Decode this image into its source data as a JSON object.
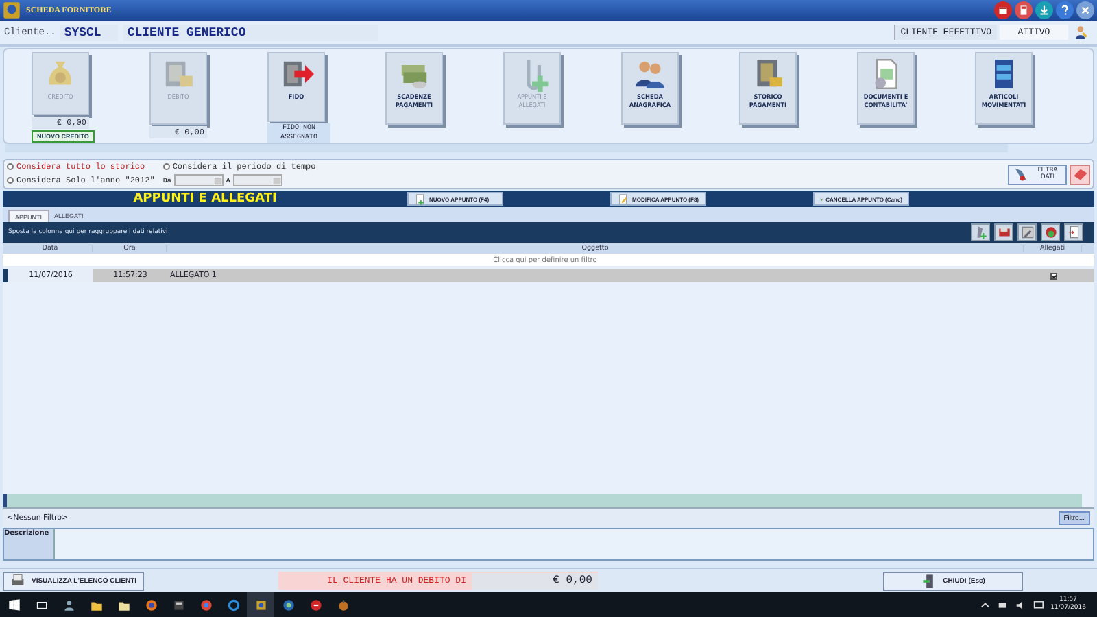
{
  "window": {
    "title": "SCHEDA FORNITORE"
  },
  "client": {
    "label": "Cliente..",
    "code": "SYSCL",
    "name": "CLIENTE GENERICO",
    "status_label": "CLIENTE EFFETTIVO",
    "status": "ATTIVO"
  },
  "tiles": [
    {
      "kind": "credit",
      "label": "CREDITO",
      "disabled": true,
      "value": "€ 0,00",
      "action": "NUOVO CREDITO"
    },
    {
      "kind": "debit",
      "label": "DEBITO",
      "disabled": true,
      "value": "€ 0,00"
    },
    {
      "kind": "fido",
      "label": "FIDO",
      "disabled": false,
      "note": "FIDO NON ASSEGNATO"
    },
    {
      "kind": "money",
      "label": "SCADENZE PAGAMENTI",
      "disabled": false
    },
    {
      "kind": "clip",
      "label": "APPUNTI E ALLEGATI",
      "disabled": true
    },
    {
      "kind": "people",
      "label": "SCHEDA ANAGRAFICA",
      "disabled": false
    },
    {
      "kind": "safe",
      "label": "STORICO PAGAMENTI",
      "disabled": false
    },
    {
      "kind": "doc",
      "label": "DOCUMENTI E CONTABILITA'",
      "disabled": false
    },
    {
      "kind": "cabinet",
      "label": "ARTICOLI MOVIMENTATI",
      "disabled": false
    }
  ],
  "period": {
    "options": [
      {
        "label": "Considera tutto lo storico",
        "selected": false,
        "emphasis": true
      },
      {
        "label": "Considera il periodo di tempo",
        "selected": false,
        "emphasis": false
      },
      {
        "label": "Considera Solo l'anno \"2012\"",
        "selected": false,
        "emphasis": false
      }
    ],
    "from_label": "Da",
    "to_label": "A",
    "filter_button": "FILTRA DATI"
  },
  "section": {
    "title": "APPUNTI E ALLEGATI",
    "actions": [
      {
        "kind": "new",
        "label": "NUOVO APPUNTO (F4)"
      },
      {
        "kind": "edit",
        "label": "MODIFICA APPUNTO (F8)"
      },
      {
        "kind": "delete",
        "label": "CANCELLA APPUNTO (Canc)"
      }
    ]
  },
  "tabs": [
    {
      "label": "APPUNTI",
      "selected": true
    },
    {
      "label": "ALLEGATI",
      "selected": false
    }
  ],
  "group_hint": "Sposta la colonna qui per raggruppare i dati relativi",
  "table": {
    "columns": [
      "Data",
      "Ora",
      "Oggetto",
      "Allegati"
    ],
    "filter_placeholder": "Clicca qui per definire un filtro",
    "rows": [
      {
        "date": "11/07/2016",
        "time": "11:57:23",
        "subject": "ALLEGATO 1",
        "attached": true
      }
    ]
  },
  "filter_footer": {
    "text": "<Nessun Filtro>",
    "button": "Filtro..."
  },
  "description": {
    "label": "Descrizione"
  },
  "bottom": {
    "list_button": "VISUALIZZA L'ELENCO CLIENTI",
    "message": "IL CLIENTE HA UN DEBITO DI",
    "amount": "€ 0,00",
    "close_button": "CHIUDI (Esc)"
  },
  "taskbar": {
    "time": "11:57",
    "date": "11/07/2016"
  }
}
